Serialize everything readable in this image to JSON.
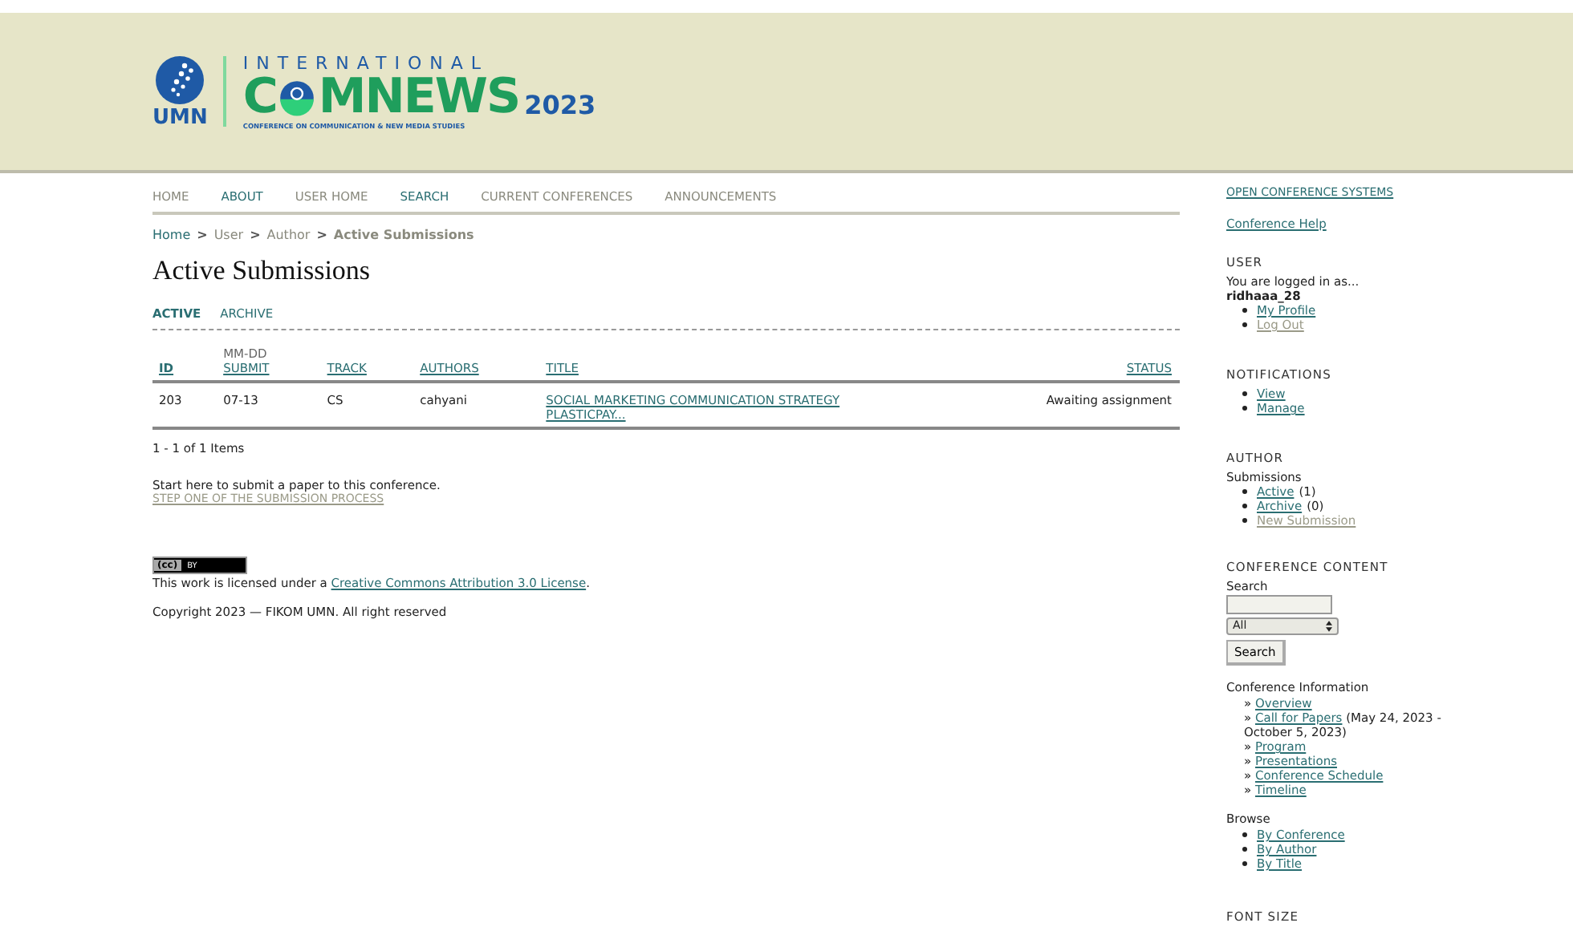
{
  "logo": {
    "umn": "UMN",
    "international": "INTERNATIONAL",
    "word_start": "C",
    "word_end": "MNEWS",
    "year": "2023",
    "tagline": "CONFERENCE ON COMMUNICATION & NEW MEDIA STUDIES"
  },
  "nav": [
    {
      "label": "HOME",
      "visited": true
    },
    {
      "label": "ABOUT",
      "visited": false
    },
    {
      "label": "USER HOME",
      "visited": true
    },
    {
      "label": "SEARCH",
      "visited": false
    },
    {
      "label": "CURRENT CONFERENCES",
      "visited": true
    },
    {
      "label": "ANNOUNCEMENTS",
      "visited": true
    }
  ],
  "breadcrumb": [
    {
      "label": "Home",
      "visited": false
    },
    {
      "label": "User",
      "visited": true
    },
    {
      "label": "Author",
      "visited": true
    },
    {
      "label": "Active Submissions",
      "visited": true
    }
  ],
  "breadcrumb_separator": ">",
  "page_title": "Active Submissions",
  "tabs": [
    {
      "label": "ACTIVE",
      "selected": true
    },
    {
      "label": "ARCHIVE",
      "selected": false
    }
  ],
  "table": {
    "columns": [
      {
        "label": "ID",
        "sorted": true
      },
      {
        "label": "SUBMIT",
        "pre": "MM-DD",
        "sorted": false
      },
      {
        "label": "TRACK",
        "sorted": false
      },
      {
        "label": "AUTHORS",
        "sorted": false
      },
      {
        "label": "TITLE",
        "sorted": false
      },
      {
        "label": "STATUS",
        "sorted": false
      }
    ],
    "rows": [
      {
        "id": "203",
        "submit": "07-13",
        "track": "CS",
        "authors": "cahyani",
        "title": "SOCIAL MARKETING COMMUNICATION STRATEGY PLASTICPAY...",
        "status": "Awaiting assignment"
      }
    ]
  },
  "item_count": "1 - 1 of 1 Items",
  "submit_intro": "Start here to submit a paper to this conference.",
  "submit_link": {
    "label": "STEP ONE OF THE SUBMISSION PROCESS",
    "visited": true
  },
  "license_badge": {
    "cc": "(cc)",
    "by": "BY"
  },
  "license_text": {
    "before": "This work is licensed under a ",
    "link": "Creative Commons Attribution 3.0 License",
    "after": "."
  },
  "copyright": "Copyright 2023 — FIKOM UMN. All right reserved",
  "sidebar": {
    "top_links": [
      "OPEN CONFERENCE SYSTEMS",
      "Conference Help"
    ],
    "user": {
      "heading": "USER",
      "logged_in": "You are logged in as...",
      "username": "ridhaaa_28",
      "links": [
        {
          "label": "My Profile",
          "visited": false
        },
        {
          "label": "Log Out",
          "visited": true
        }
      ]
    },
    "notifications": {
      "heading": "NOTIFICATIONS",
      "links": [
        {
          "label": "View",
          "visited": false
        },
        {
          "label": "Manage",
          "visited": false
        }
      ]
    },
    "author": {
      "heading": "AUTHOR",
      "sub": "Submissions",
      "links": [
        {
          "label": "Active",
          "count": "(1)",
          "visited": false
        },
        {
          "label": "Archive",
          "count": "(0)",
          "visited": false
        },
        {
          "label": "New Submission",
          "visited": true
        }
      ]
    },
    "content": {
      "heading": "CONFERENCE CONTENT",
      "search_label": "Search",
      "select_value": "All",
      "search_button": "Search",
      "info_heading": "Conference Information",
      "info_links": [
        {
          "mark": "»",
          "label": "Overview"
        },
        {
          "mark": "»",
          "label": "Call for Papers",
          "note": "(May 24, 2023 - October 5, 2023)"
        },
        {
          "mark": "»",
          "label": "Program"
        },
        {
          "mark": "»",
          "label": "Presentations"
        },
        {
          "mark": "»",
          "label": "Conference Schedule"
        },
        {
          "mark": "»",
          "label": "Timeline"
        }
      ],
      "browse_heading": "Browse",
      "browse_links": [
        "By Conference",
        "By Author",
        "By Title"
      ]
    },
    "font_size_heading": "FONT SIZE"
  }
}
